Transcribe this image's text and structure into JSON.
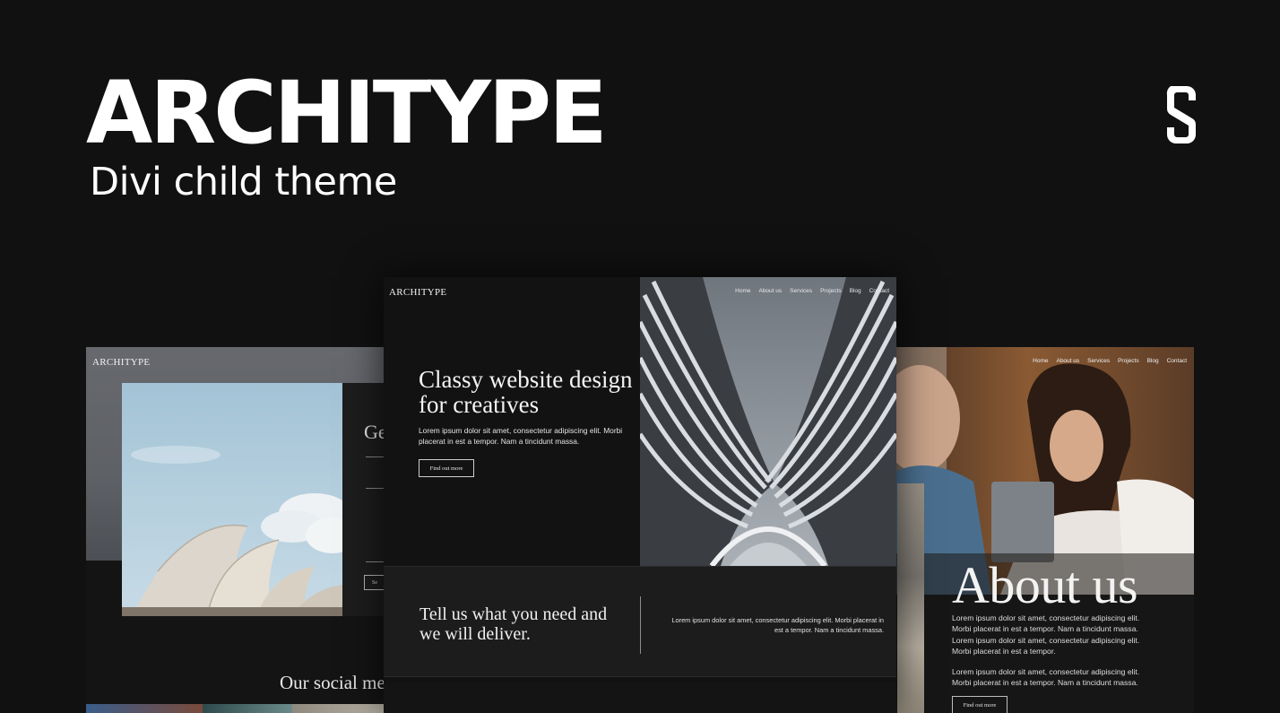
{
  "header": {
    "title": "ARCHITYPE",
    "subtitle": "Divi child theme",
    "logo_icon": "divi-logo-icon"
  },
  "mock_left": {
    "logo": "ARCHITYPE",
    "contact_heading": "Ge",
    "send_label": "Se",
    "social_heading": "Our social me"
  },
  "mock_center": {
    "logo": "ARCHITYPE",
    "nav": [
      "Home",
      "About us",
      "Services",
      "Projects",
      "Blog",
      "Contact"
    ],
    "headline": "Classy website design for creatives",
    "hero_text": "Lorem ipsum dolor sit amet, consectetur adipiscing elit. Morbi placerat in est a tempor. Nam a tincidunt massa.",
    "hero_button": "Find out more",
    "band_heading": "Tell us what you need and we will deliver.",
    "band_text": "Lorem ipsum dolor sit amet, consectetur adipiscing elit. Morbi placerat in est a tempor. Nam a tincidunt massa."
  },
  "mock_right": {
    "nav": [
      "Home",
      "About us",
      "Services",
      "Projects",
      "Blog",
      "Contact"
    ],
    "about_title": "About us",
    "para1": "Lorem ipsum dolor sit amet, consectetur adipiscing elit. Morbi placerat in est a tempor. Nam a tincidunt massa. Lorem ipsum dolor sit amet, consectetur adipiscing elit. Morbi placerat in est a tempor.",
    "para2": "Lorem ipsum dolor sit amet, consectetur adipiscing elit. Morbi placerat in est a tempor. Nam a tincidunt massa.",
    "button": "Find out more"
  },
  "colors": {
    "background": "#111112",
    "text": "#ffffff"
  }
}
